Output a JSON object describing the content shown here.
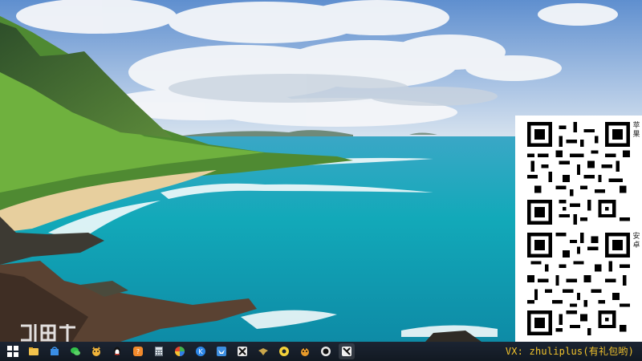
{
  "wallpaper": {
    "subject": "coastal-landscape",
    "colors": {
      "sky": "#7ea7d8",
      "ocean": "#1aa3b8",
      "sand": "#e8d3a6",
      "mountain": "#3f6a3a"
    }
  },
  "qr_panel": {
    "labels": [
      "苹果",
      "安卓"
    ]
  },
  "taskbar": {
    "icons": [
      {
        "name": "windows-start-icon"
      },
      {
        "name": "file-explorer-icon"
      },
      {
        "name": "store-icon"
      },
      {
        "name": "wechat-icon"
      },
      {
        "name": "cat-app-icon"
      },
      {
        "name": "qq-penguin-icon"
      },
      {
        "name": "orange-app-icon"
      },
      {
        "name": "calculator-icon"
      },
      {
        "name": "color-wheel-icon"
      },
      {
        "name": "kugou-music-icon"
      },
      {
        "name": "bird-app-icon"
      },
      {
        "name": "dark-game-icon"
      },
      {
        "name": "eagle-app-icon"
      },
      {
        "name": "yellow-circle-icon"
      },
      {
        "name": "tiger-app-icon"
      },
      {
        "name": "dark-circle-app-icon"
      },
      {
        "name": "game-logo-icon"
      }
    ],
    "promo_text": "VX: zhuliplus(有礼包哟)"
  },
  "colors": {
    "taskbar": "#151c26",
    "promo": "#f2c32c"
  }
}
